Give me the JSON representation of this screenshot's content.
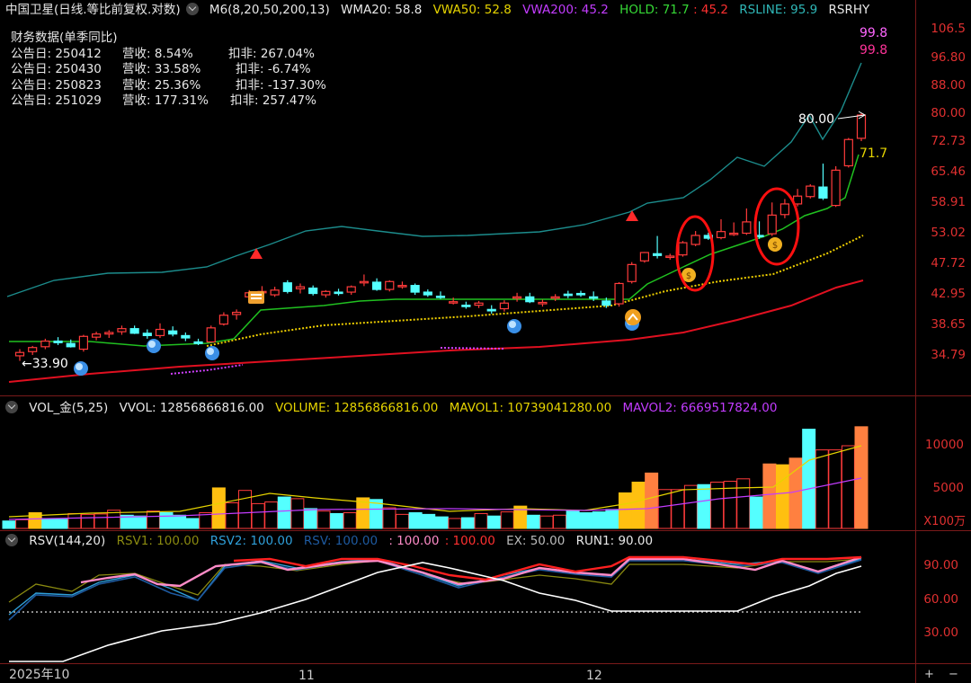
{
  "main_header": {
    "title": "中国卫星(日线.等比前复权.对数)",
    "ma": "M6(8,20,50,200,13)",
    "wma": "WMA20: 58.8",
    "vwa50": "VWA50: 52.8",
    "vwa200": "VWA200: 45.2",
    "hold": "HOLD: 71.7",
    "hold_extra": ": 45.2",
    "rsline": "RSLINE: 95.9",
    "rsrhy": "RSRHY"
  },
  "financial": {
    "title": "财务数据(单季同比)",
    "rows": [
      {
        "date": "公告日: 250412",
        "rev": "营收:  8.54%",
        "np": "扣非:  267.04%"
      },
      {
        "date": "公告日: 250430",
        "rev": "营收: 33.58%",
        "np": "扣非:  -6.74%"
      },
      {
        "date": "公告日: 250823",
        "rev": "营收: 25.36%",
        "np": "扣非:  -137.30%"
      },
      {
        "date": "公告日: 251029",
        "rev": "营收: 177.31%",
        "np": "扣非:  257.47%"
      }
    ]
  },
  "price_axis": [
    "106.5",
    "96.80",
    "88.00",
    "80.00",
    "72.73",
    "65.46",
    "58.91",
    "53.02",
    "47.72",
    "42.95",
    "38.65",
    "34.79"
  ],
  "annotations": {
    "rs_top1": "99.8",
    "rs_top2": "99.8",
    "high_mark": "80.00",
    "low_mark": "←33.90",
    "hold_label": "71.7"
  },
  "vol_header": {
    "name": "VOL_金(5,25)",
    "vvol": "VVOL: 12856866816.00",
    "volume": "VOLUME: 12856866816.00",
    "mavol1": "MAVOL1: 10739041280.00",
    "mavol2": "MAVOL2: 6669517824.00"
  },
  "vol_axis": [
    "10000",
    "5000"
  ],
  "vol_unit": "X100万",
  "rsv_header": {
    "name": "RSV(144,20)",
    "rsv1": "RSV1: 100.00",
    "rsv2": "RSV2: 100.00",
    "rsv": "RSV: 100.00",
    "a": ": 100.00",
    "b": ": 100.00",
    "ex": "EX: 50.00",
    "run1": "RUN1: 90.00"
  },
  "rsv_axis": [
    "90.00",
    "60.00",
    "30.00"
  ],
  "dates": {
    "d1": "2025年10",
    "d2": "11",
    "d3": "12"
  },
  "controls": {
    "plus": "+",
    "minus": "−"
  },
  "colors": {
    "up": "#ff3b3b",
    "down": "#54ffff",
    "ma_green": "#20c020",
    "vwa50": "#f0d000",
    "vwa200": "#c000ff",
    "red_line": "#e01020",
    "rsline": "#1c8c8c",
    "text_yellow": "#e6d400"
  },
  "chart_data": {
    "type": "candlestick",
    "price_scale": "log",
    "ylim": [
      33.0,
      108.0
    ],
    "candles": [
      {
        "o": 34.8,
        "h": 35.6,
        "l": 34.2,
        "c": 35.2,
        "dir": "up"
      },
      {
        "o": 35.3,
        "h": 36.0,
        "l": 34.9,
        "c": 35.8,
        "dir": "up"
      },
      {
        "o": 35.9,
        "h": 36.9,
        "l": 35.6,
        "c": 36.6,
        "dir": "up"
      },
      {
        "o": 36.6,
        "h": 37.1,
        "l": 36.1,
        "c": 36.4,
        "dir": "down"
      },
      {
        "o": 36.3,
        "h": 36.8,
        "l": 35.8,
        "c": 35.9,
        "dir": "down"
      },
      {
        "o": 35.6,
        "h": 37.4,
        "l": 35.3,
        "c": 37.2,
        "dir": "up"
      },
      {
        "o": 37.1,
        "h": 37.8,
        "l": 36.7,
        "c": 37.5,
        "dir": "up"
      },
      {
        "o": 37.5,
        "h": 38.0,
        "l": 37.0,
        "c": 37.7,
        "dir": "up"
      },
      {
        "o": 37.8,
        "h": 38.6,
        "l": 37.4,
        "c": 38.2,
        "dir": "up"
      },
      {
        "o": 38.2,
        "h": 38.6,
        "l": 37.5,
        "c": 37.6,
        "dir": "down"
      },
      {
        "o": 37.6,
        "h": 38.1,
        "l": 36.9,
        "c": 37.3,
        "dir": "down"
      },
      {
        "o": 37.3,
        "h": 38.9,
        "l": 37.0,
        "c": 38.1,
        "dir": "up"
      },
      {
        "o": 37.9,
        "h": 38.5,
        "l": 37.2,
        "c": 37.5,
        "dir": "down"
      },
      {
        "o": 37.3,
        "h": 37.7,
        "l": 36.6,
        "c": 37.0,
        "dir": "down"
      },
      {
        "o": 36.5,
        "h": 36.9,
        "l": 36.1,
        "c": 36.3,
        "dir": "down"
      },
      {
        "o": 36.5,
        "h": 38.6,
        "l": 36.4,
        "c": 38.3,
        "dir": "up"
      },
      {
        "o": 38.8,
        "h": 40.4,
        "l": 38.6,
        "c": 40.0,
        "dir": "up"
      },
      {
        "o": 40.1,
        "h": 40.8,
        "l": 39.4,
        "c": 40.4,
        "dir": "up"
      },
      {
        "o": 42.6,
        "h": 43.6,
        "l": 42.1,
        "c": 43.2,
        "dir": "up"
      },
      {
        "o": 43.4,
        "h": 44.2,
        "l": 42.9,
        "c": 43.4,
        "dir": "up"
      },
      {
        "o": 42.9,
        "h": 44.1,
        "l": 42.6,
        "c": 43.6,
        "dir": "up"
      },
      {
        "o": 44.7,
        "h": 45.1,
        "l": 43.1,
        "c": 43.4,
        "dir": "down"
      },
      {
        "o": 43.8,
        "h": 44.6,
        "l": 43.1,
        "c": 44.1,
        "dir": "up"
      },
      {
        "o": 43.9,
        "h": 44.3,
        "l": 42.8,
        "c": 43.1,
        "dir": "down"
      },
      {
        "o": 42.9,
        "h": 43.6,
        "l": 42.5,
        "c": 43.4,
        "dir": "up"
      },
      {
        "o": 43.3,
        "h": 43.8,
        "l": 42.8,
        "c": 43.1,
        "dir": "down"
      },
      {
        "o": 43.3,
        "h": 44.3,
        "l": 42.9,
        "c": 44.1,
        "dir": "up"
      },
      {
        "o": 44.9,
        "h": 46.0,
        "l": 44.2,
        "c": 44.9,
        "dir": "up"
      },
      {
        "o": 44.8,
        "h": 45.4,
        "l": 43.5,
        "c": 43.7,
        "dir": "down"
      },
      {
        "o": 43.7,
        "h": 45.1,
        "l": 43.4,
        "c": 44.9,
        "dir": "up"
      },
      {
        "o": 44.3,
        "h": 44.9,
        "l": 43.8,
        "c": 44.3,
        "dir": "up"
      },
      {
        "o": 44.3,
        "h": 44.6,
        "l": 42.9,
        "c": 43.3,
        "dir": "down"
      },
      {
        "o": 43.3,
        "h": 43.7,
        "l": 42.6,
        "c": 42.9,
        "dir": "down"
      },
      {
        "o": 42.7,
        "h": 43.4,
        "l": 42.3,
        "c": 42.5,
        "dir": "down"
      },
      {
        "o": 41.8,
        "h": 42.5,
        "l": 41.5,
        "c": 41.9,
        "dir": "up"
      },
      {
        "o": 41.4,
        "h": 41.9,
        "l": 40.9,
        "c": 41.2,
        "dir": "down"
      },
      {
        "o": 41.4,
        "h": 42.0,
        "l": 41.0,
        "c": 41.7,
        "dir": "up"
      },
      {
        "o": 40.8,
        "h": 41.4,
        "l": 40.2,
        "c": 40.6,
        "dir": "down"
      },
      {
        "o": 40.9,
        "h": 42.1,
        "l": 40.5,
        "c": 41.7,
        "dir": "up"
      },
      {
        "o": 42.4,
        "h": 43.2,
        "l": 41.9,
        "c": 42.6,
        "dir": "up"
      },
      {
        "o": 42.6,
        "h": 43.2,
        "l": 41.7,
        "c": 41.9,
        "dir": "down"
      },
      {
        "o": 41.8,
        "h": 42.2,
        "l": 41.2,
        "c": 41.6,
        "dir": "up"
      },
      {
        "o": 42.4,
        "h": 43.0,
        "l": 42.0,
        "c": 42.6,
        "dir": "up"
      },
      {
        "o": 43.0,
        "h": 43.5,
        "l": 42.4,
        "c": 42.8,
        "dir": "down"
      },
      {
        "o": 43.0,
        "h": 43.5,
        "l": 42.6,
        "c": 43.1,
        "dir": "down"
      },
      {
        "o": 42.6,
        "h": 43.4,
        "l": 42.0,
        "c": 42.5,
        "dir": "down"
      },
      {
        "o": 42.0,
        "h": 42.5,
        "l": 41.0,
        "c": 41.4,
        "dir": "down"
      },
      {
        "o": 41.6,
        "h": 44.8,
        "l": 41.2,
        "c": 44.6,
        "dir": "up"
      },
      {
        "o": 44.9,
        "h": 48.0,
        "l": 44.6,
        "c": 47.6,
        "dir": "up"
      },
      {
        "o": 48.2,
        "h": 49.7,
        "l": 47.9,
        "c": 49.6,
        "dir": "up"
      },
      {
        "o": 49.4,
        "h": 52.5,
        "l": 48.6,
        "c": 49.1,
        "dir": "down"
      },
      {
        "o": 49.0,
        "h": 49.4,
        "l": 48.4,
        "c": 48.8,
        "dir": "up"
      },
      {
        "o": 49.2,
        "h": 51.6,
        "l": 48.9,
        "c": 51.3,
        "dir": "up"
      },
      {
        "o": 51.0,
        "h": 53.4,
        "l": 50.7,
        "c": 52.6,
        "dir": "up"
      },
      {
        "o": 52.6,
        "h": 53.1,
        "l": 51.8,
        "c": 52.1,
        "dir": "down"
      },
      {
        "o": 52.2,
        "h": 55.6,
        "l": 51.9,
        "c": 53.3,
        "dir": "up"
      },
      {
        "o": 53.0,
        "h": 55.0,
        "l": 52.5,
        "c": 52.8,
        "dir": "up"
      },
      {
        "o": 53.0,
        "h": 57.7,
        "l": 52.7,
        "c": 55.1,
        "dir": "up"
      },
      {
        "o": 52.6,
        "h": 55.2,
        "l": 52.0,
        "c": 52.4,
        "dir": "down"
      },
      {
        "o": 52.9,
        "h": 58.9,
        "l": 52.5,
        "c": 56.4,
        "dir": "up"
      },
      {
        "o": 56.5,
        "h": 59.6,
        "l": 55.8,
        "c": 58.6,
        "dir": "up"
      },
      {
        "o": 58.6,
        "h": 61.7,
        "l": 58.1,
        "c": 60.2,
        "dir": "up"
      },
      {
        "o": 60.1,
        "h": 62.7,
        "l": 59.7,
        "c": 62.3,
        "dir": "up"
      },
      {
        "o": 62.1,
        "h": 67.3,
        "l": 59.4,
        "c": 59.8,
        "dir": "down"
      },
      {
        "o": 58.3,
        "h": 66.7,
        "l": 58.0,
        "c": 65.8,
        "dir": "up"
      },
      {
        "o": 66.8,
        "h": 73.5,
        "l": 66.4,
        "c": 73.1,
        "dir": "up"
      },
      {
        "o": 73.4,
        "h": 80.0,
        "l": 72.7,
        "c": 79.5,
        "dir": "up"
      }
    ],
    "volume": [
      {
        "v": 900,
        "dir": "down"
      },
      {
        "v": 1050,
        "dir": "up"
      },
      {
        "v": 1900,
        "dir": "gold"
      },
      {
        "v": 1200,
        "dir": "down"
      },
      {
        "v": 1100,
        "dir": "down"
      },
      {
        "v": 1800,
        "dir": "up"
      },
      {
        "v": 1700,
        "dir": "up"
      },
      {
        "v": 1750,
        "dir": "up"
      },
      {
        "v": 2200,
        "dir": "up"
      },
      {
        "v": 1600,
        "dir": "down"
      },
      {
        "v": 1500,
        "dir": "down"
      },
      {
        "v": 2100,
        "dir": "up"
      },
      {
        "v": 1900,
        "dir": "down"
      },
      {
        "v": 1600,
        "dir": "down"
      },
      {
        "v": 1200,
        "dir": "down"
      },
      {
        "v": 1900,
        "dir": "up"
      },
      {
        "v": 4900,
        "dir": "gold"
      },
      {
        "v": 3100,
        "dir": "up"
      },
      {
        "v": 4600,
        "dir": "up"
      },
      {
        "v": 3000,
        "dir": "up"
      },
      {
        "v": 3200,
        "dir": "up"
      },
      {
        "v": 3800,
        "dir": "down"
      },
      {
        "v": 3600,
        "dir": "up"
      },
      {
        "v": 2400,
        "dir": "down"
      },
      {
        "v": 2100,
        "dir": "up"
      },
      {
        "v": 1800,
        "dir": "down"
      },
      {
        "v": 1900,
        "dir": "up"
      },
      {
        "v": 3700,
        "dir": "gold"
      },
      {
        "v": 3500,
        "dir": "down"
      },
      {
        "v": 2500,
        "dir": "up"
      },
      {
        "v": 1700,
        "dir": "up"
      },
      {
        "v": 1900,
        "dir": "down"
      },
      {
        "v": 1700,
        "dir": "down"
      },
      {
        "v": 1400,
        "dir": "down"
      },
      {
        "v": 1200,
        "dir": "up"
      },
      {
        "v": 1300,
        "dir": "down"
      },
      {
        "v": 1800,
        "dir": "up"
      },
      {
        "v": 1500,
        "dir": "down"
      },
      {
        "v": 2000,
        "dir": "up"
      },
      {
        "v": 2700,
        "dir": "gold"
      },
      {
        "v": 1600,
        "dir": "down"
      },
      {
        "v": 1500,
        "dir": "up"
      },
      {
        "v": 1600,
        "dir": "up"
      },
      {
        "v": 2100,
        "dir": "down"
      },
      {
        "v": 1900,
        "dir": "down"
      },
      {
        "v": 2000,
        "dir": "down"
      },
      {
        "v": 2300,
        "dir": "down"
      },
      {
        "v": 4300,
        "dir": "gold"
      },
      {
        "v": 5600,
        "dir": "gold"
      },
      {
        "v": 6700,
        "dir": "orange"
      },
      {
        "v": 4700,
        "dir": "up"
      },
      {
        "v": 4700,
        "dir": "up"
      },
      {
        "v": 5200,
        "dir": "up"
      },
      {
        "v": 5300,
        "dir": "down"
      },
      {
        "v": 5600,
        "dir": "up"
      },
      {
        "v": 5700,
        "dir": "up"
      },
      {
        "v": 6000,
        "dir": "up"
      },
      {
        "v": 3800,
        "dir": "down"
      },
      {
        "v": 7800,
        "dir": "orange"
      },
      {
        "v": 7700,
        "dir": "gold"
      },
      {
        "v": 8500,
        "dir": "orange"
      },
      {
        "v": 12000,
        "dir": "down"
      },
      {
        "v": 9500,
        "dir": "up"
      },
      {
        "v": 9500,
        "dir": "up"
      },
      {
        "v": 10000,
        "dir": "up"
      },
      {
        "v": 12300,
        "dir": "orange"
      }
    ],
    "volume_axis_ticks": [
      10000,
      5000
    ],
    "rsv_axis_ticks": [
      90,
      60,
      30
    ]
  }
}
